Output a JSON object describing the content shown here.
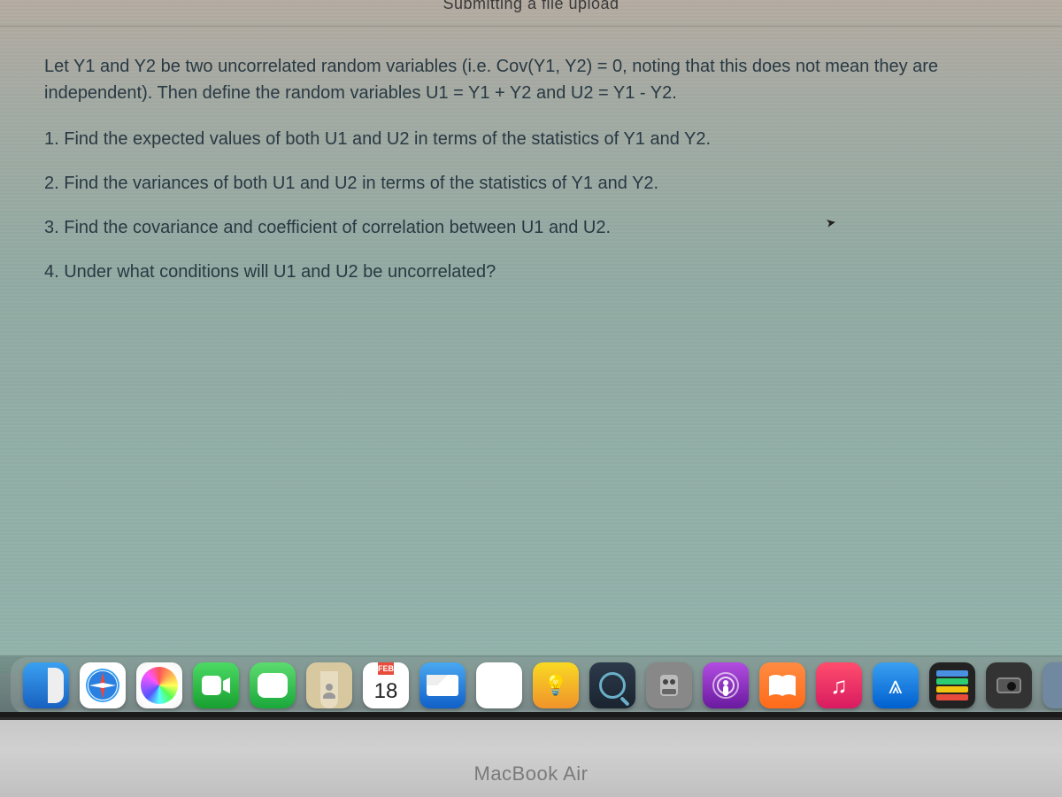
{
  "header": {
    "fragment": "Submitting a file upload"
  },
  "problem": {
    "intro": "Let Y1 and Y2 be two uncorrelated random variables (i.e. Cov(Y1, Y2) = 0, noting that this does not mean they are independent). Then define the random variables U1 = Y1 + Y2 and U2 = Y1 - Y2.",
    "questions": [
      "1. Find the expected values of both U1 and U2 in terms of the statistics of Y1 and Y2.",
      "2. Find the variances of both U1 and U2 in terms of the statistics of Y1 and Y2.",
      "3. Find the covariance and coefficient of correlation between U1 and U2.",
      "4. Under what conditions will U1 and U2 be uncorrelated?"
    ]
  },
  "dock": {
    "calendar": {
      "month": "FEB",
      "day": "18"
    },
    "icons": [
      "finder",
      "safari",
      "photos",
      "facetime",
      "messages",
      "contacts",
      "calendar",
      "mail",
      "reminders",
      "tips",
      "preview",
      "automator",
      "podcasts",
      "books",
      "music",
      "appstore",
      "wallet",
      "camera",
      "generic"
    ]
  },
  "device": {
    "label": "MacBook Air"
  }
}
